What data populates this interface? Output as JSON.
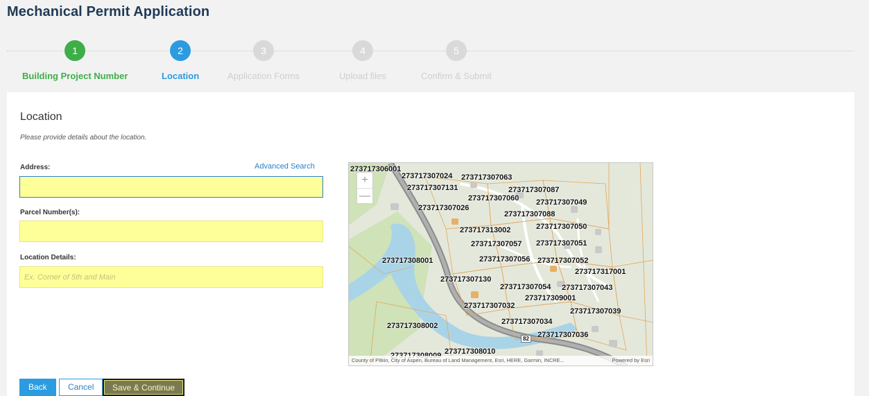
{
  "page": {
    "title": "Mechanical Permit Application"
  },
  "steps": [
    {
      "number": "1",
      "label": "Building Project Number",
      "state": "done"
    },
    {
      "number": "2",
      "label": "Location",
      "state": "active"
    },
    {
      "number": "3",
      "label": "Application Forms",
      "state": "todo"
    },
    {
      "number": "4",
      "label": "Upload files",
      "state": "todo"
    },
    {
      "number": "5",
      "label": "Confirm & Submit",
      "state": "todo"
    }
  ],
  "section": {
    "title": "Location",
    "subtitle": "Please provide details about the location."
  },
  "form": {
    "address_label": "Address:",
    "advanced_search": "Advanced Search",
    "address_value": "",
    "parcel_label": "Parcel Number(s):",
    "parcel_value": "",
    "details_label": "Location Details:",
    "details_placeholder": "Ex. Corner of 5th and Main"
  },
  "map": {
    "zoom_in": "+",
    "zoom_out": "—",
    "attribution": "County of Pitkin, City of Aspen, Bureau of Land Management, Esri, HERE, Garmin, INCRE...",
    "powered_by": "Powered by Esri",
    "road_label": "82",
    "parcels": [
      "273717306001",
      "273717307024",
      "273717307063",
      "273717307131",
      "273717307087",
      "273717307060",
      "273717307049",
      "273717307026",
      "273717307088",
      "273717307050",
      "273717313002",
      "273717307057",
      "273717307051",
      "273717308001",
      "273717307056",
      "273717307052",
      "273717317001",
      "273717307130",
      "273717307054",
      "273717307043",
      "273717309001",
      "273717307032",
      "273717307039",
      "273717307034",
      "273717308002",
      "273717307036",
      "273717308010",
      "273717308009"
    ]
  },
  "buttons": {
    "back": "Back",
    "cancel": "Cancel",
    "save": "Save & Continue"
  },
  "colors": {
    "done": "#3fae49",
    "active": "#2c9be0",
    "todo": "#d9d9d9",
    "field_highlight": "#ffff99"
  }
}
